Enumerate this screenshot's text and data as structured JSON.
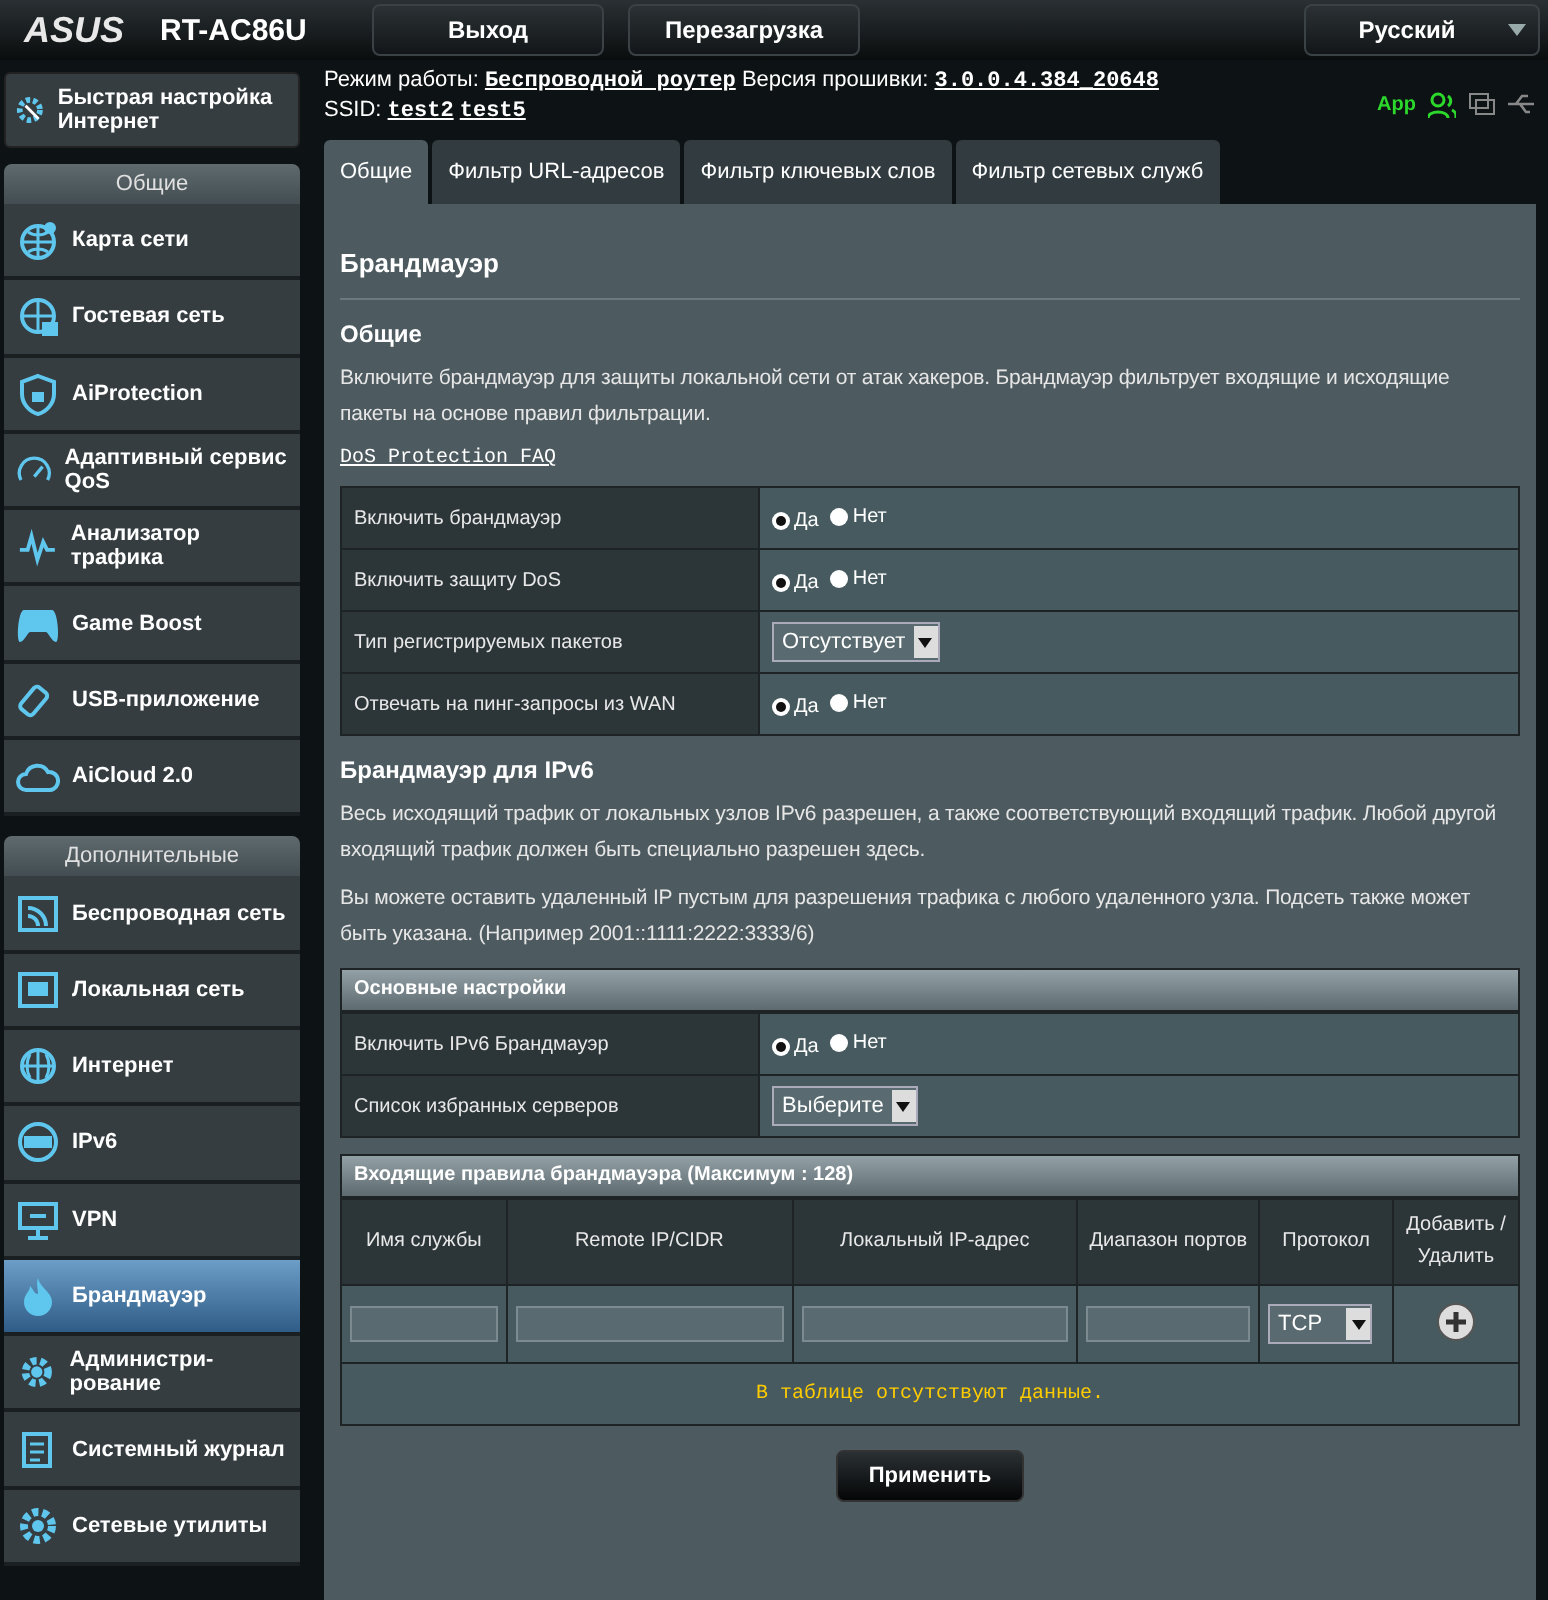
{
  "header": {
    "brand": "ASUS",
    "model": "RT-AC86U",
    "buttons": [
      "Выход",
      "Перезагрузка"
    ],
    "language": "Русский"
  },
  "status": {
    "mode_label": "Режим работы:",
    "mode": "Беспроводной роутер",
    "fw_label": "Версия прошивки:",
    "fw": "3.0.0.4.384_20648",
    "ssid_label": "SSID:",
    "ssids": [
      "test2",
      "test5"
    ],
    "app": "App"
  },
  "quick_setup": "Быстрая настройка Интернет",
  "sidebar": [
    {
      "title": "Общие",
      "items": [
        {
          "label": "Карта сети",
          "selected": false
        },
        {
          "label": "Гостевая сеть",
          "selected": false
        },
        {
          "label": "AiProtection",
          "selected": false
        },
        {
          "label": "Адаптивный сервис QoS",
          "selected": false
        },
        {
          "label": "Анализатор трафика",
          "selected": false
        },
        {
          "label": "Game Boost",
          "selected": false
        },
        {
          "label": "USB-приложение",
          "selected": false
        },
        {
          "label": "AiCloud 2.0",
          "selected": false
        }
      ]
    },
    {
      "title": "Дополнительные",
      "items": [
        {
          "label": "Беспроводная сеть",
          "selected": false
        },
        {
          "label": "Локальная сеть",
          "selected": false
        },
        {
          "label": "Интернет",
          "selected": false
        },
        {
          "label": "IPv6",
          "selected": false
        },
        {
          "label": "VPN",
          "selected": false
        },
        {
          "label": "Брандмауэр",
          "selected": true
        },
        {
          "label": "Администри-рование",
          "selected": false
        },
        {
          "label": "Системный журнал",
          "selected": false
        },
        {
          "label": "Сетевые утилиты",
          "selected": false
        }
      ]
    }
  ],
  "tabs": [
    {
      "label": "Общие",
      "selected": true
    },
    {
      "label": "Фильтр URL-адресов",
      "selected": false
    },
    {
      "label": "Фильтр ключевых слов",
      "selected": false
    },
    {
      "label": "Фильтр сетевых служб",
      "selected": false
    }
  ],
  "page_title": "Брандмауэр",
  "general": {
    "title": "Общие",
    "description": "Включите брандмауэр для защиты локальной сети от атак хакеров. Брандмауэр фильтрует входящие и исходящие пакеты на основе правил фильтрации.",
    "link": "DoS Protection FAQ",
    "rows": [
      {
        "kind": "radio",
        "label": "Включить брандмауэр",
        "options": [
          {
            "label": "Да",
            "selected": true
          },
          {
            "label": "Нет",
            "selected": false
          }
        ]
      },
      {
        "kind": "radio",
        "label": "Включить защиту DoS",
        "options": [
          {
            "label": "Да",
            "selected": true
          },
          {
            "label": "Нет",
            "selected": false
          }
        ]
      },
      {
        "kind": "select",
        "label": "Тип регистрируемых пакетов",
        "value": "Отсутствует"
      },
      {
        "kind": "radio",
        "label": "Отвечать на пинг-запросы из WAN",
        "options": [
          {
            "label": "Да",
            "selected": true
          },
          {
            "label": "Нет",
            "selected": false
          }
        ]
      }
    ]
  },
  "ipv6": {
    "title": "Брандмауэр для IPv6",
    "paragraphs": [
      "Весь исходящий трафик от локальных узлов IPv6 разрешен, а также соответствующий входящий трафик. Любой другой входящий трафик должен быть специально разрешен здесь.",
      "Вы можете оставить удаленный IP пустым для разрешения трафика с любого удаленного узла. Подсеть также может быть указана. (Например 2001::1111:2222:3333/6)"
    ],
    "basic": {
      "title": "Основные настройки",
      "rows": [
        {
          "kind": "radio",
          "label": "Включить IPv6 Брандмауэр",
          "options": [
            {
              "label": "Да",
              "selected": true
            },
            {
              "label": "Нет",
              "selected": false
            }
          ]
        },
        {
          "kind": "select",
          "label": "Список избранных серверов",
          "value": "Выберите"
        }
      ]
    },
    "rules": {
      "title": "Входящие правила брандмауэра (Максимум : 128)",
      "columns": [
        "Имя службы",
        "Remote IP/CIDR",
        "Локальный IP-адрес",
        "Диапазон портов",
        "Протокол",
        "Добавить / Удалить"
      ],
      "protocol": "TCP",
      "empty": "В таблице отсутствуют данные."
    }
  },
  "apply": "Применить"
}
